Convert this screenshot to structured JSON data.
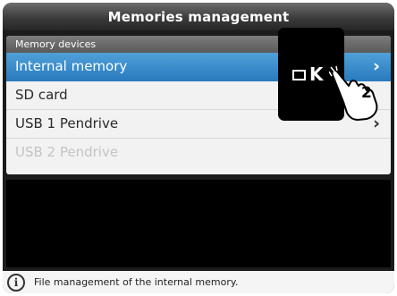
{
  "title": "Memories management",
  "panel": {
    "section_header": "Memory devices",
    "items": [
      {
        "label": "Internal memory",
        "state": "selected",
        "has_chevron": true
      },
      {
        "label": "SD card",
        "state": "normal",
        "has_chevron": false
      },
      {
        "label": "USB 1 Pendrive",
        "state": "normal",
        "has_chevron": true
      },
      {
        "label": "USB 2 Pendrive",
        "state": "disabled",
        "has_chevron": false
      }
    ],
    "chevron_glyph": "›"
  },
  "status": {
    "icon": "info-icon",
    "icon_glyph": "i",
    "text": "File management of the internal memory."
  },
  "ok_overlay": {
    "glyph": "K",
    "step": "2"
  },
  "colors": {
    "selected_highlight": "#2a7bbf",
    "title_bar": "#3c3c3c",
    "panel_bg": "#f2f2f2"
  }
}
